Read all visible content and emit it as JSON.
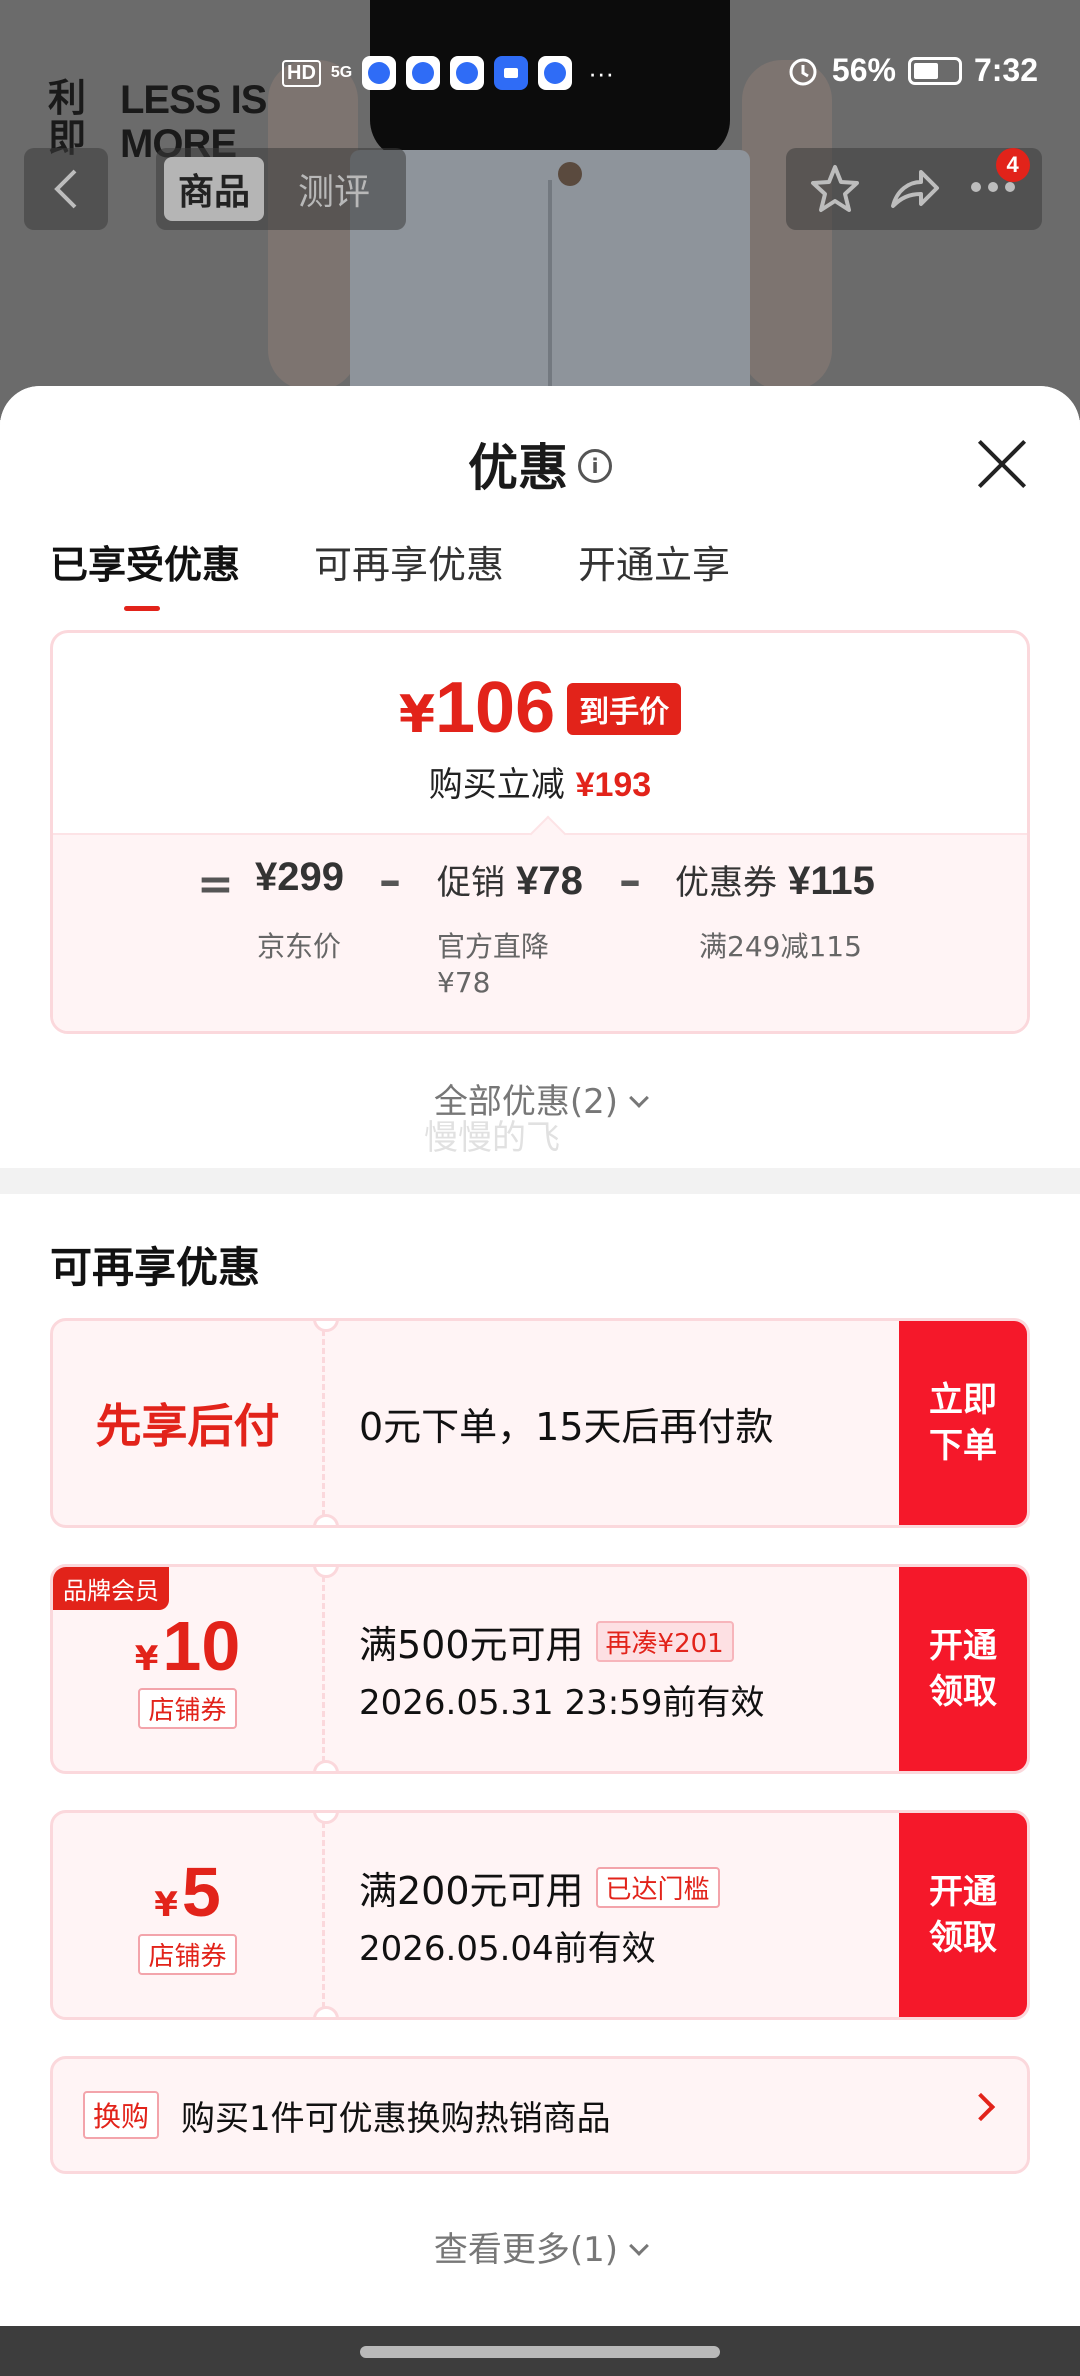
{
  "status_bar": {
    "hd": "HD",
    "network": "5G",
    "overflow": "···",
    "battery": "56%",
    "time": "7:32"
  },
  "brand": {
    "cn": "利即",
    "en": "LESS IS MORE"
  },
  "top_nav": {
    "tabs": [
      "商品",
      "测评"
    ],
    "cart_badge": "4"
  },
  "sheet": {
    "title": "优惠",
    "tabs": [
      "已享受优惠",
      "可再享优惠",
      "开通立享"
    ],
    "price_card": {
      "final_price_symbol": "¥",
      "final_price": "106",
      "final_tag": "到手价",
      "save_label": "购买立减",
      "save_amount": "¥193",
      "eq": "=",
      "minus": "–",
      "jd_price": "¥299",
      "jd_price_label": "京东价",
      "promo_label": "促销",
      "promo_amount": "¥78",
      "promo_sub": "官方直降",
      "promo_sub_amount": "¥78",
      "coupon_label": "优惠券",
      "coupon_amount": "¥115",
      "coupon_sub": "满249减115"
    },
    "all_offers": "全部优惠(2)",
    "watermark": "慢慢的飞",
    "more_section_title": "可再享优惠",
    "offers": [
      {
        "left": "先享后付",
        "desc": "0元下单，15天后再付款",
        "cta": "立即下单"
      },
      {
        "badge": "品牌会员",
        "yen": "¥",
        "value": "10",
        "type": "店铺券",
        "condition": "满500元可用",
        "tag": "再凑¥201",
        "validity": "2026.05.31 23:59前有效",
        "cta": "开通领取"
      },
      {
        "yen": "¥",
        "value": "5",
        "type": "店铺券",
        "condition": "满200元可用",
        "tag": "已达门槛",
        "validity": "2026.05.04前有效",
        "cta": "开通领取"
      }
    ],
    "swap": {
      "tag": "换购",
      "text": "购买1件可优惠换购热销商品"
    },
    "see_more": "查看更多(1)"
  },
  "colors": {
    "accent": "#e2231a",
    "card_bg": "#fff4f5",
    "card_border": "#fbd8dc"
  }
}
